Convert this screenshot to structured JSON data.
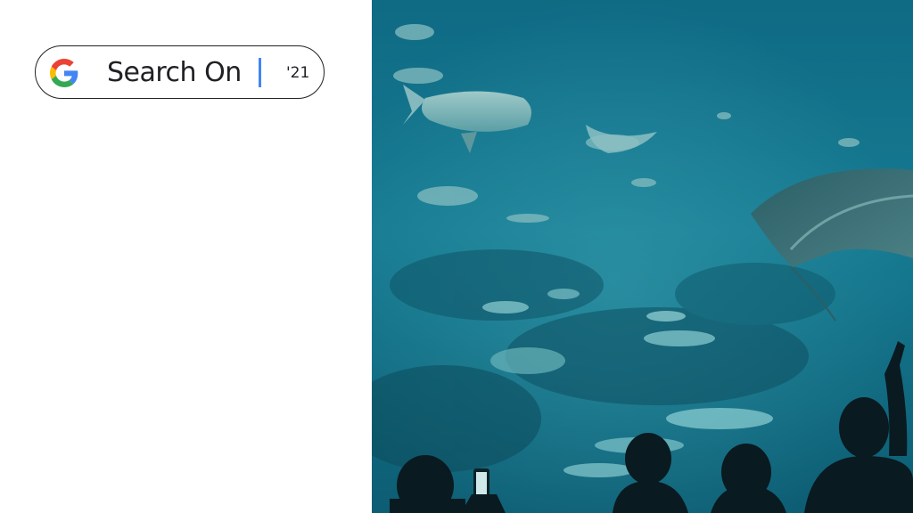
{
  "header": {
    "brand": "Search On",
    "year": "'21"
  },
  "icons": {
    "logo": "google-g-logo"
  },
  "colors": {
    "google_blue": "#4285F4",
    "google_red": "#EA4335",
    "google_yellow": "#FBBC05",
    "google_green": "#34A853",
    "water": "#136b86"
  }
}
